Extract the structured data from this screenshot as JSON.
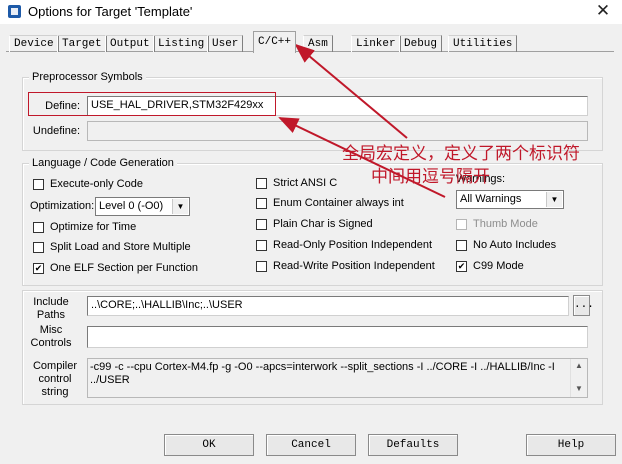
{
  "window": {
    "title": "Options for Target 'Template'",
    "close_glyph": "✕"
  },
  "tabs": [
    {
      "label": "Device",
      "active": false
    },
    {
      "label": "Target",
      "active": false
    },
    {
      "label": "Output",
      "active": false
    },
    {
      "label": "Listing",
      "active": false
    },
    {
      "label": "User",
      "active": false
    },
    {
      "label": "C/C++",
      "active": true
    },
    {
      "label": "Asm",
      "active": false
    },
    {
      "label": "Linker",
      "active": false
    },
    {
      "label": "Debug",
      "active": false
    },
    {
      "label": "Utilities",
      "active": false
    }
  ],
  "preprocessor": {
    "group_label": "Preprocessor Symbols",
    "define_label": "Define:",
    "define_value": "USE_HAL_DRIVER,STM32F429xx",
    "undefine_label": "Undefine:",
    "undefine_value": ""
  },
  "language": {
    "group_label": "Language / Code Generation",
    "execute_only": {
      "label": "Execute-only Code",
      "checked": false
    },
    "optimization_label": "Optimization:",
    "optimization_value": "Level 0 (-O0)",
    "optimize_time": {
      "label": "Optimize for Time",
      "checked": false
    },
    "split_load": {
      "label": "Split Load and Store Multiple",
      "checked": false
    },
    "one_elf": {
      "label": "One ELF Section per Function",
      "checked": true
    },
    "strict_ansi": {
      "label": "Strict ANSI C",
      "checked": false
    },
    "enum_int": {
      "label": "Enum Container always int",
      "checked": false
    },
    "plain_char": {
      "label": "Plain Char is Signed",
      "checked": false
    },
    "ro_pos": {
      "label": "Read-Only Position Independent",
      "checked": false
    },
    "rw_pos": {
      "label": "Read-Write Position Independent",
      "checked": false
    },
    "warnings_label": "Warnings:",
    "warnings_value": "All Warnings",
    "thumb_mode": {
      "label": "Thumb Mode",
      "checked": false,
      "disabled": true
    },
    "no_auto_includes": {
      "label": "No Auto Includes",
      "checked": false
    },
    "c99_mode": {
      "label": "C99 Mode",
      "checked": true
    }
  },
  "include": {
    "label_line1": "Include",
    "label_line2": "Paths",
    "value": "..\\CORE;..\\HALLIB\\Inc;..\\USER",
    "browse_label": "..."
  },
  "misc": {
    "label_line1": "Misc",
    "label_line2": "Controls",
    "value": ""
  },
  "compiler": {
    "label_line1": "Compiler",
    "label_line2": "control",
    "label_line3": "string",
    "value": "-c99 -c --cpu Cortex-M4.fp -g -O0 --apcs=interwork --split_sections -I ../CORE -I ../HALLIB/Inc -I ../USER"
  },
  "buttons": {
    "ok": "OK",
    "cancel": "Cancel",
    "defaults": "Defaults",
    "help": "Help"
  },
  "annotation": {
    "line1": "全局宏定义，定义了两个标识符",
    "line2": "中间用逗号隔开",
    "color": "#c0182a"
  },
  "icons": {
    "check": "✔",
    "dropdown": "▼",
    "scroll_up": "▲",
    "scroll_down": "▼"
  }
}
